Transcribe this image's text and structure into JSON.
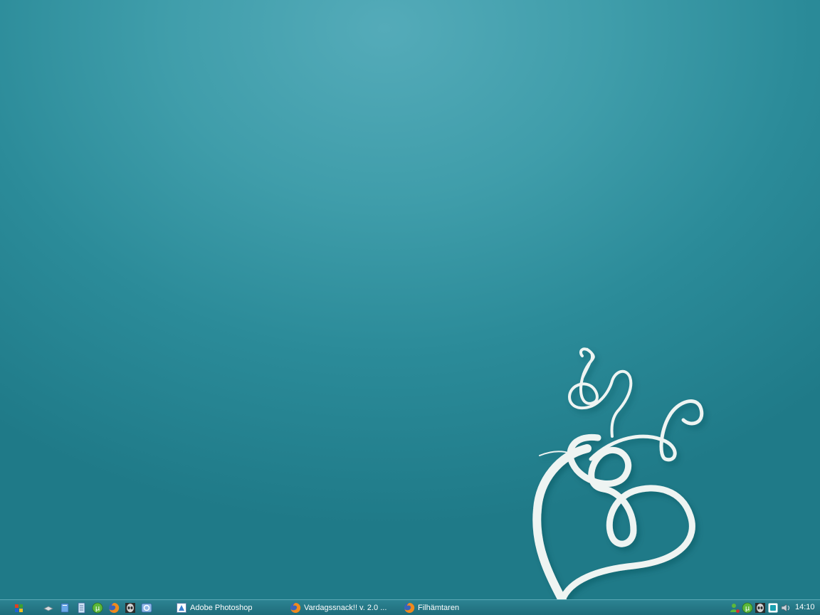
{
  "desktop": {
    "background_color": "#2b8b99",
    "art_color": "#eef4f2"
  },
  "taskbar": {
    "start_icon": "windows-grid-icon",
    "quick_launch": [
      {
        "name": "show-desktop-icon"
      },
      {
        "name": "documents-icon"
      },
      {
        "name": "notepad-icon"
      },
      {
        "name": "utorrent-icon"
      },
      {
        "name": "firefox-icon"
      },
      {
        "name": "alien-app-icon"
      },
      {
        "name": "browser-icon"
      }
    ],
    "tasks": [
      {
        "label": "Adobe Photoshop",
        "icon": "photoshop-icon"
      },
      {
        "label": "Vardagssnack!! v. 2.0 ...",
        "icon": "firefox-icon"
      },
      {
        "label": "Filhämtaren",
        "icon": "firefox-icon"
      }
    ],
    "tray": [
      {
        "name": "network-user-icon"
      },
      {
        "name": "utorrent-tray-icon"
      },
      {
        "name": "alien-tray-icon"
      },
      {
        "name": "messenger-tray-icon"
      },
      {
        "name": "volume-icon"
      }
    ],
    "clock": "14:10"
  }
}
